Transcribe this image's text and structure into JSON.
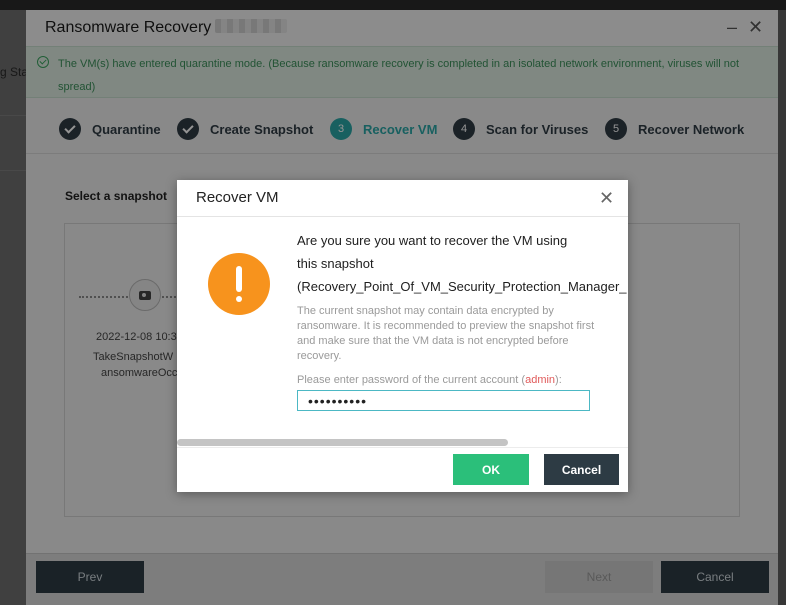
{
  "background": {
    "left_text": "g Stat"
  },
  "wizard": {
    "title": "Ransomware Recovery",
    "minimize_glyph": "–",
    "close_glyph": "✕",
    "banner": "The VM(s) have entered quarantine mode. (Because ransomware recovery is completed in an isolated network environment, viruses will not spread)",
    "steps": [
      {
        "number": "",
        "label": "Quarantine",
        "state": "done"
      },
      {
        "number": "",
        "label": "Create Snapshot",
        "state": "done"
      },
      {
        "number": "3",
        "label": "Recover VM",
        "state": "active"
      },
      {
        "number": "4",
        "label": "Scan for Viruses",
        "state": "pending"
      },
      {
        "number": "5",
        "label": "Recover Network",
        "state": "pending"
      }
    ],
    "content_label": "Select a snapshot",
    "snapshot": {
      "date": "2022-12-08 10:3",
      "name_line1": "TakeSnapshotW",
      "name_line2": "ansomwareOcc"
    },
    "footer": {
      "prev_label": "Prev",
      "next_label": "Next",
      "cancel_label": "Cancel"
    }
  },
  "modal": {
    "title": "Recover VM",
    "close_glyph": "✕",
    "question_line1": "Are you sure you want to recover the VM using",
    "question_line2": "this snapshot",
    "question_line3": "(Recovery_Point_Of_VM_Security_Protection_Manager_",
    "description": "The current snapshot may contain data encrypted by ransomware. It is recommended to preview the snapshot first and make sure that the VM data is not encrypted before recovery.",
    "password_label_prefix": "Please enter password of the current account (",
    "password_user": "admin",
    "password_label_suffix": "):",
    "password_value": "••••••••••",
    "ok_label": "OK",
    "cancel_label": "Cancel"
  },
  "colors": {
    "accent": "#2aa5a5",
    "ok_green": "#2bbf7a",
    "warning_orange": "#f7931d",
    "dark_button": "#2d3b44"
  }
}
